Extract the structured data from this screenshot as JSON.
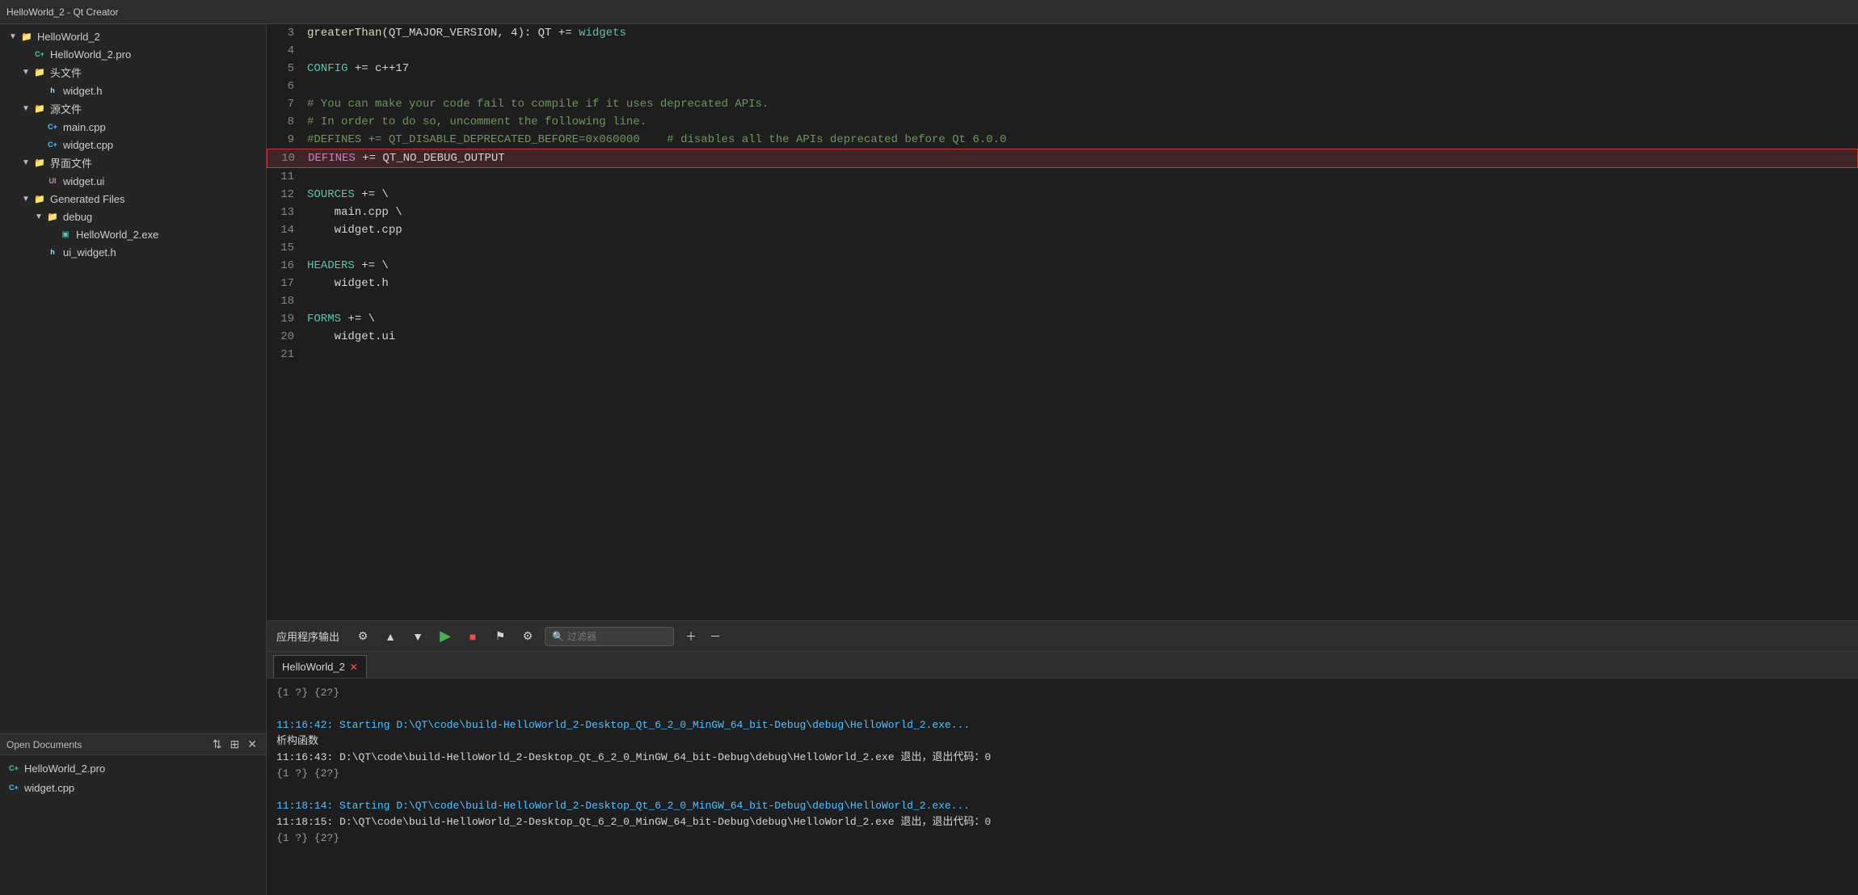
{
  "titleBar": {
    "text": "HelloWorld_2 - Qt Creator"
  },
  "sidebar": {
    "projectLabel": "HelloWorld_2",
    "proFile": "HelloWorld_2.pro",
    "headersFolder": "头文件",
    "widgetH": "widget.h",
    "sourcesFolder": "源文件",
    "mainCpp": "main.cpp",
    "widgetCpp": "widget.cpp",
    "formsFolder": "界面文件",
    "widgetUi": "widget.ui",
    "generatedFiles": "Generated Files",
    "debugFolder": "debug",
    "exeFile": "HelloWorld_2.exe",
    "uiWidgetH": "ui_widget.h"
  },
  "openDocs": {
    "label": "Open Documents",
    "items": [
      {
        "name": "HelloWorld_2.pro",
        "type": "pro"
      },
      {
        "name": "widget.cpp",
        "type": "cpp"
      }
    ]
  },
  "editor": {
    "lines": [
      {
        "num": 3,
        "text": "greaterThan(QT_MAJOR_VERSION, 4): QT += widgets"
      },
      {
        "num": 4,
        "text": ""
      },
      {
        "num": 5,
        "text": "CONFIG += c++17"
      },
      {
        "num": 6,
        "text": ""
      },
      {
        "num": 7,
        "text": "# You can make your code fail to compile if it uses deprecated APIs."
      },
      {
        "num": 8,
        "text": "# In order to do so, uncomment the following line."
      },
      {
        "num": 9,
        "text": "#DEFINES += QT_DISABLE_DEPRECATED_BEFORE=0x060000    # disables all the APIs deprecated before Qt 6.0.0"
      },
      {
        "num": 10,
        "text": "DEFINES += QT_NO_DEBUG_OUTPUT",
        "highlighted": true
      },
      {
        "num": 11,
        "text": ""
      },
      {
        "num": 12,
        "text": "SOURCES += \\"
      },
      {
        "num": 13,
        "text": "    main.cpp \\"
      },
      {
        "num": 14,
        "text": "    widget.cpp"
      },
      {
        "num": 15,
        "text": ""
      },
      {
        "num": 16,
        "text": "HEADERS += \\"
      },
      {
        "num": 17,
        "text": "    widget.h"
      },
      {
        "num": 18,
        "text": ""
      },
      {
        "num": 19,
        "text": "FORMS += \\"
      },
      {
        "num": 20,
        "text": "    widget.ui"
      },
      {
        "num": 21,
        "text": ""
      }
    ]
  },
  "outputPanel": {
    "title": "应用程序输出",
    "searchPlaceholder": "过滤器",
    "activeTab": "HelloWorld_2",
    "lines": [
      {
        "text": "{1 ?} {2?}",
        "color": "gray"
      },
      {
        "text": "",
        "color": "white"
      },
      {
        "text": "11:16:42: Starting D:\\QT\\code\\build-HelloWorld_2-Desktop_Qt_6_2_0_MinGW_64_bit-Debug\\debug\\HelloWorld_2.exe...",
        "color": "blue"
      },
      {
        "text": "析构函数",
        "color": "white"
      },
      {
        "text": "11:16:43: D:\\QT\\code\\build-HelloWorld_2-Desktop_Qt_6_2_0_MinGW_64_bit-Debug\\debug\\HelloWorld_2.exe 退出，退出代码：0",
        "color": "white"
      },
      {
        "text": "{1 ?} {2?}",
        "color": "gray"
      },
      {
        "text": "",
        "color": "white"
      },
      {
        "text": "11:18:14: Starting D:\\QT\\code\\build-HelloWorld_2-Desktop_Qt_6_2_0_MinGW_64_bit-Debug\\debug\\HelloWorld_2.exe...",
        "color": "blue"
      },
      {
        "text": "11:18:15: D:\\QT\\code\\build-HelloWorld_2-Desktop_Qt_6_2_0_MinGW_64_bit-Debug\\debug\\HelloWorld_2.exe 退出，退出代码：0",
        "color": "white"
      },
      {
        "text": "{1 ?} {2?}",
        "color": "gray"
      }
    ]
  }
}
